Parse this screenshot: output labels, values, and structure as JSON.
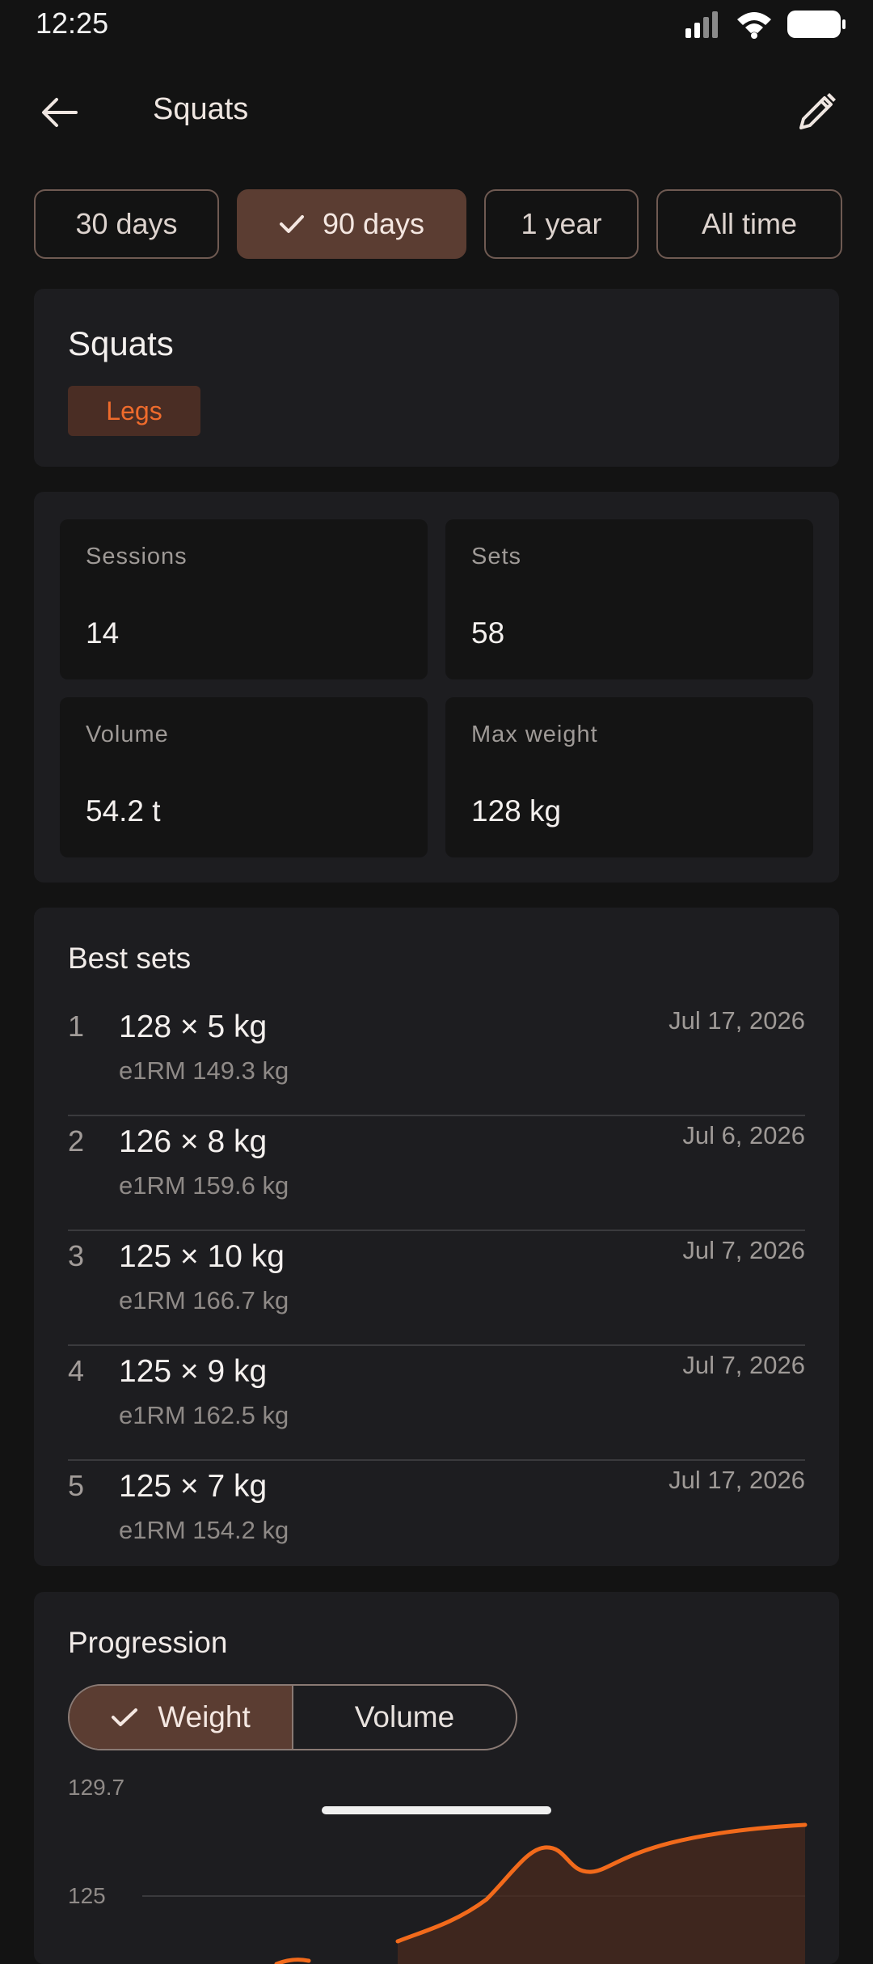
{
  "status_bar": {
    "time": "12:25"
  },
  "app_bar": {
    "title": "Squats"
  },
  "range_filters": [
    {
      "label": "30 days",
      "selected": false
    },
    {
      "label": "90 days",
      "selected": true
    },
    {
      "label": "1 year",
      "selected": false
    },
    {
      "label": "All time",
      "selected": false
    }
  ],
  "exercise": {
    "name": "Squats",
    "category": "Legs"
  },
  "stats": {
    "sessions": {
      "label": "Sessions",
      "value": "14"
    },
    "sets": {
      "label": "Sets",
      "value": "58"
    },
    "volume": {
      "label": "Volume",
      "value": "54.2 t"
    },
    "max_weight": {
      "label": "Max weight",
      "value": "128 kg"
    }
  },
  "best_sets": {
    "title": "Best sets",
    "items": [
      {
        "rank": "1",
        "set": "128 × 5 kg",
        "e1rm": "e1RM 149.3 kg",
        "date": "Jul 17, 2026"
      },
      {
        "rank": "2",
        "set": "126 × 8 kg",
        "e1rm": "e1RM 159.6 kg",
        "date": "Jul 6, 2026"
      },
      {
        "rank": "3",
        "set": "125 × 10 kg",
        "e1rm": "e1RM 166.7 kg",
        "date": "Jul 7, 2026"
      },
      {
        "rank": "4",
        "set": "125 × 9 kg",
        "e1rm": "e1RM 162.5 kg",
        "date": "Jul 7, 2026"
      },
      {
        "rank": "5",
        "set": "125 × 7 kg",
        "e1rm": "e1RM 154.2 kg",
        "date": "Jul 17, 2026"
      }
    ]
  },
  "progression": {
    "title": "Progression",
    "toggle": [
      {
        "label": "Weight",
        "selected": true
      },
      {
        "label": "Volume",
        "selected": false
      }
    ],
    "y_ticks": [
      "129.7",
      "125"
    ]
  },
  "colors": {
    "accent": "#f26a1b",
    "selected_bg": "#5b3d32",
    "tag_text": "#ef6b2c"
  }
}
